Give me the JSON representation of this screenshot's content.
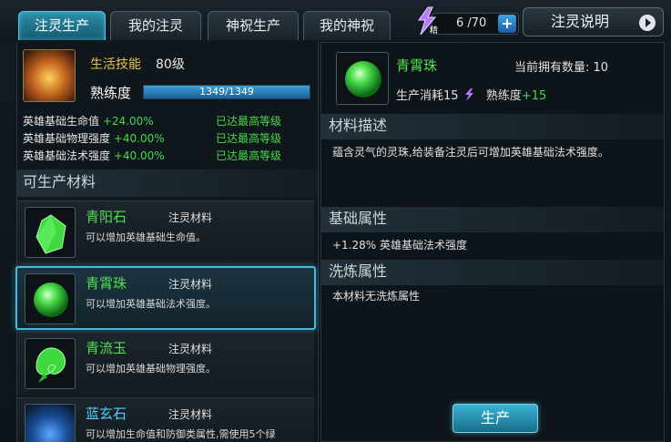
{
  "tabs": [
    {
      "label": "注灵生产",
      "active": true
    },
    {
      "label": "我的注灵",
      "active": false
    },
    {
      "label": "神祝生产",
      "active": false
    },
    {
      "label": "我的神祝",
      "active": false
    }
  ],
  "essence": {
    "icon": "spirit-essence-icon",
    "count": "6 /70",
    "plus": "+"
  },
  "help_button": "注灵说明",
  "skill": {
    "name": "生活技能",
    "level": "80级",
    "proficiency_label": "熟练度",
    "proficiency_text": "1349/1349",
    "proficiency_fraction": 1.0
  },
  "stats": [
    {
      "label": "英雄基础生命值",
      "value": "+24.00%",
      "status": "已达最高等级"
    },
    {
      "label": "英雄基础物理强度",
      "value": "+40.00%",
      "status": "已达最高等级"
    },
    {
      "label": "英雄基础法术强度",
      "value": "+40.00%",
      "status": "已达最高等级"
    }
  ],
  "materials_title": "可生产材料",
  "materials": [
    {
      "name": "青阳石",
      "type": "注灵材料",
      "desc": "可以增加英雄基础生命值。",
      "icon": "green-crystal-icon",
      "selected": false
    },
    {
      "name": "青霄珠",
      "type": "注灵材料",
      "desc": "可以增加英雄基础法术强度。",
      "icon": "green-orb-icon",
      "selected": true
    },
    {
      "name": "青流玉",
      "type": "注灵材料",
      "desc": "可以增加英雄基础物理强度。",
      "icon": "green-jade-icon",
      "selected": false
    },
    {
      "name": "蓝玄石",
      "type": "注灵材料",
      "desc": "可以增加生命值和防御类属性,需使用5个绿",
      "icon": "blue-stone-icon",
      "selected": false
    }
  ],
  "detail": {
    "name": "青霄珠",
    "owned": "当前拥有数量: 10",
    "cost_label": "生产消耗15",
    "proficiency_label": "熟练度",
    "proficiency_gain": "+15",
    "desc_title": "材料描述",
    "desc": "蕴含灵气的灵珠,给装备注灵后可增加英雄基础法术强度。",
    "base_title": "基础属性",
    "base": "+1.28% 英雄基础法术强度",
    "refine_title": "洗炼属性",
    "refine": "本材料无洗炼属性",
    "produce_button": "生产"
  }
}
